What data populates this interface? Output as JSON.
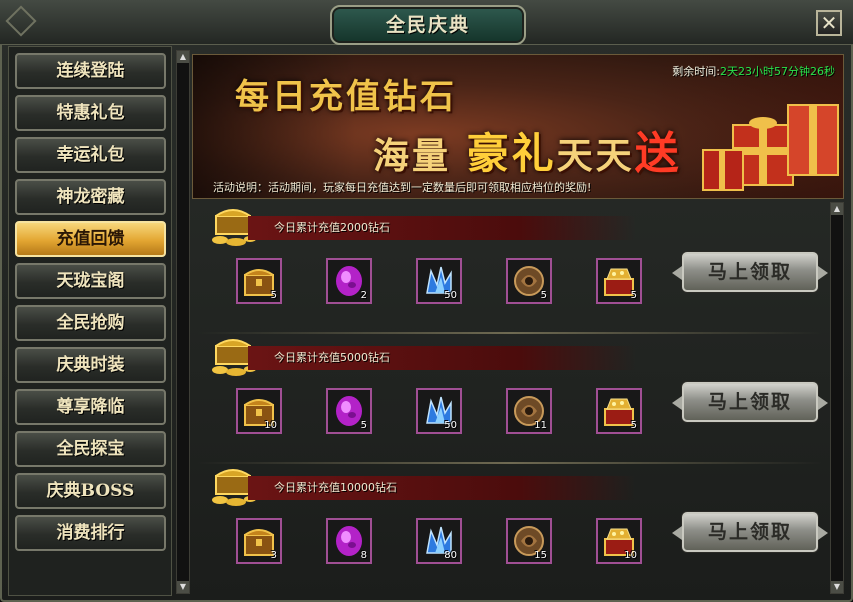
{
  "window": {
    "title": "全民庆典",
    "close_label": "✕"
  },
  "sidebar": {
    "items": [
      {
        "label": "连续登陆",
        "active": false
      },
      {
        "label": "特惠礼包",
        "active": false
      },
      {
        "label": "幸运礼包",
        "active": false
      },
      {
        "label": "神龙密藏",
        "active": false
      },
      {
        "label": "充值回馈",
        "active": true
      },
      {
        "label": "天珑宝阁",
        "active": false
      },
      {
        "label": "全民抢购",
        "active": false
      },
      {
        "label": "庆典时装",
        "active": false
      },
      {
        "label": "尊享降临",
        "active": false
      },
      {
        "label": "全民探宝",
        "active": false
      },
      {
        "label": "庆典BOSS",
        "active": false
      },
      {
        "label": "消费排行",
        "active": false
      }
    ]
  },
  "banner": {
    "title_line1": "每日充值钻石",
    "title_line2_a": "海量",
    "title_line2_b": "豪礼",
    "title_line2_c": "天天",
    "title_line2_d": "送",
    "countdown_label": "剩余时间:",
    "countdown_value": "2天23小时57分钟26秒",
    "desc_label": "活动说明：",
    "desc_text": "活动期间，玩家每日充值达到一定数量后即可领取相应档位的奖励!"
  },
  "tiers": [
    {
      "heading": "今日累计充值2000钻石",
      "claim_label": "马上领取",
      "rewards": [
        {
          "icon": "treasure-chest-icon",
          "qty": "5"
        },
        {
          "icon": "purple-gem-icon",
          "qty": "2"
        },
        {
          "icon": "blue-crystal-icon",
          "qty": "50"
        },
        {
          "icon": "bronze-coin-icon",
          "qty": "5"
        },
        {
          "icon": "gold-box-icon",
          "qty": "5"
        }
      ]
    },
    {
      "heading": "今日累计充值5000钻石",
      "claim_label": "马上领取",
      "rewards": [
        {
          "icon": "treasure-chest-icon",
          "qty": "10"
        },
        {
          "icon": "purple-gem-icon",
          "qty": "5"
        },
        {
          "icon": "blue-crystal-icon",
          "qty": "50"
        },
        {
          "icon": "bronze-coin-icon",
          "qty": "11"
        },
        {
          "icon": "gold-box-icon",
          "qty": "5"
        }
      ]
    },
    {
      "heading": "今日累计充值10000钻石",
      "claim_label": "马上领取",
      "rewards": [
        {
          "icon": "treasure-chest-icon",
          "qty": "3"
        },
        {
          "icon": "purple-gem-icon",
          "qty": "8"
        },
        {
          "icon": "blue-crystal-icon",
          "qty": "80"
        },
        {
          "icon": "bronze-coin-icon",
          "qty": "15"
        },
        {
          "icon": "gold-box-icon",
          "qty": "10"
        }
      ]
    }
  ],
  "scroll_arrows": {
    "up": "▲",
    "down": "▼"
  }
}
